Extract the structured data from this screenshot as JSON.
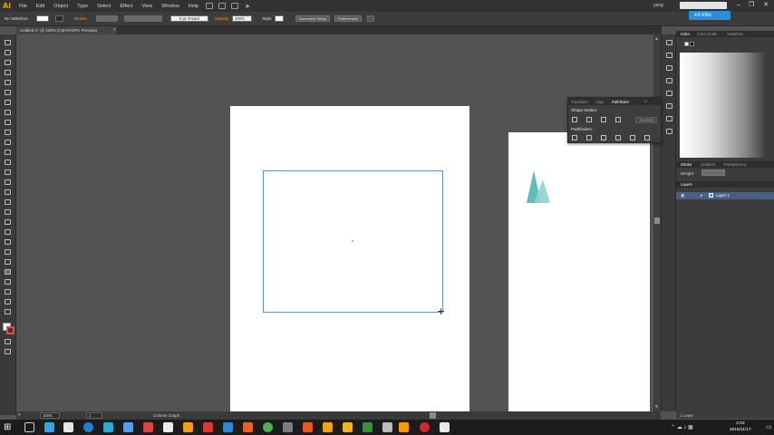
{
  "app": {
    "logo": "Ai"
  },
  "menu": [
    "File",
    "Edit",
    "Object",
    "Type",
    "Select",
    "Effect",
    "View",
    "Window",
    "Help"
  ],
  "user": "yang",
  "net_speed": "4.6 KB/s",
  "control_bar": {
    "selection": "No Selection",
    "stroke_label": "Stroke:",
    "brush": "5 pt. Round",
    "opacity_label": "Opacity",
    "opacity_value": "100%",
    "style_label": "Style:",
    "document_setup": "Document Setup",
    "preferences": "Preferences"
  },
  "document_tab": {
    "label": "Untitled-1* @ 100% (CMYK/GPU Preview)",
    "close": "×"
  },
  "status_bar": {
    "zoom": "100%",
    "page": "1",
    "tool": "Column Graph"
  },
  "panels": {
    "color_tabs": [
      "Color",
      "Color Guide",
      "Swatches"
    ],
    "stroke_tabs": [
      "Stroke",
      "Gradient",
      "Transparency"
    ],
    "weight_label": "Weight:",
    "layers_tab": "Layers",
    "layer_name": "Layer 1",
    "layers_count": "1 Layer"
  },
  "pathfinder": {
    "tabs": [
      "Transform",
      "Align",
      "Pathfinder"
    ],
    "shape_modes": "Shape Modes:",
    "pathfinders": "Pathfinders:",
    "expand": "Expand"
  },
  "clock": {
    "time": "2:03",
    "date": "2016/11/17"
  },
  "colors": {
    "accent": "#ff9a00",
    "selection": "#6b8fd4",
    "shape": "#5fbdbb",
    "layer_highlight": "#4a5f86"
  }
}
